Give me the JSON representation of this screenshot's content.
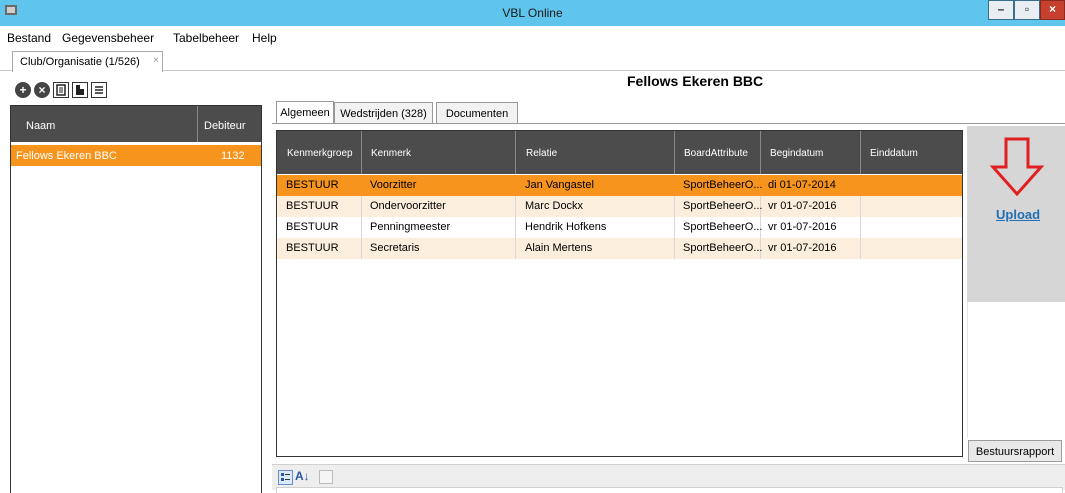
{
  "window": {
    "title": "VBL Online",
    "min_glyph": "–",
    "max_glyph": "▫",
    "close_glyph": "×"
  },
  "menu": [
    "Bestand",
    "Gegevensbeheer",
    "Tabelbeheer",
    "Help"
  ],
  "doc_tab": {
    "label": "Club/Organisatie (1/526)",
    "close": "×"
  },
  "toolbar": {
    "icons": [
      "add-icon",
      "remove-icon",
      "form-icon",
      "copy-icon",
      "list-icon"
    ],
    "add_glyph": "+",
    "remove_glyph": "×"
  },
  "left_list": {
    "columns": [
      "Naam",
      "Debiteur"
    ],
    "rows": [
      {
        "naam": "Fellows Ekeren BBC",
        "debiteur": "1132"
      }
    ]
  },
  "org_title": "Fellows Ekeren BBC",
  "subtabs": [
    "Algemeen",
    "Wedstrijden (328)",
    "Documenten"
  ],
  "grid": {
    "columns": [
      "Kenmerkgroep",
      "Kenmerk",
      "Relatie",
      "BoardAttribute",
      "Begindatum",
      "Einddatum"
    ],
    "rows": [
      {
        "groep": "BESTUUR",
        "kenmerk": "Voorzitter",
        "relatie": "Jan Vangastel",
        "board": "SportBeheerO...",
        "begin": "di 01-07-2014",
        "eind": ""
      },
      {
        "groep": "BESTUUR",
        "kenmerk": "Ondervoorzitter",
        "relatie": "Marc Dockx",
        "board": "SportBeheerO...",
        "begin": "vr 01-07-2016",
        "eind": ""
      },
      {
        "groep": "BESTUUR",
        "kenmerk": "Penningmeester",
        "relatie": "Hendrik Hofkens",
        "board": "SportBeheerO...",
        "begin": "vr 01-07-2016",
        "eind": ""
      },
      {
        "groep": "BESTUUR",
        "kenmerk": "Secretaris",
        "relatie": "Alain Mertens",
        "board": "SportBeheerO...",
        "begin": "vr 01-07-2016",
        "eind": ""
      }
    ]
  },
  "upload_label": "Upload",
  "bestuursrapport_label": "Bestuursrapport",
  "property_toolbar": {
    "categorized_icon": "categorized-icon",
    "sort_az_glyph": "A↓",
    "sort_az_icon": "sort-az-icon",
    "pages_icon": "property-pages-icon"
  },
  "colors": {
    "titlebar": "#5fc5ec",
    "header": "#4c4c4c",
    "selected_row": "#f7941d",
    "alt_row": "#fbeedd",
    "upload_link": "#1f6fb2",
    "arrow": "#e02020"
  }
}
